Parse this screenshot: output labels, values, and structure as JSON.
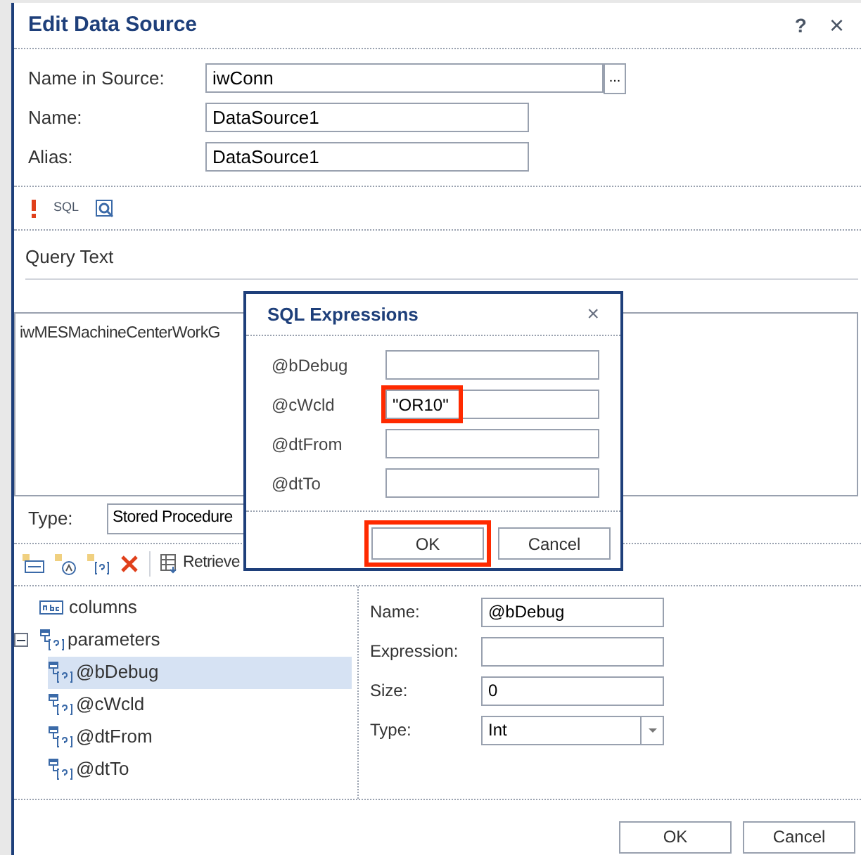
{
  "window": {
    "title": "Edit Data Source",
    "help": "?",
    "close": "×"
  },
  "fields": [
    {
      "label": "Name in Source:",
      "value": "iwConn",
      "browse": "..."
    },
    {
      "label": "Name:",
      "value": "DataSource1"
    },
    {
      "label": "Alias:",
      "value": "DataSource1"
    }
  ],
  "toolbar": {
    "sql_label": "SQL"
  },
  "query": {
    "heading": "Query Text",
    "text": "iwMESMachineCenterWorkG"
  },
  "type": {
    "label": "Type:",
    "value": "Stored Procedure"
  },
  "tree_toolbar": {
    "retrieve": "Retrieve"
  },
  "tree": [
    {
      "label": "columns",
      "kind": "columns",
      "selected": false
    },
    {
      "label": "parameters",
      "kind": "group",
      "expanded": true,
      "selected": false,
      "children": [
        {
          "label": "@bDebug",
          "kind": "param",
          "selected": true
        },
        {
          "label": "@cWcld",
          "kind": "param",
          "selected": false
        },
        {
          "label": "@dtFrom",
          "kind": "param",
          "selected": false
        },
        {
          "label": "@dtTo",
          "kind": "param",
          "selected": false
        }
      ]
    }
  ],
  "properties": [
    {
      "label": "Name:",
      "value": "@bDebug",
      "kind": "text"
    },
    {
      "label": "Expression:",
      "kind": "text"
    },
    {
      "label": "Size:",
      "value": "0",
      "kind": "text"
    },
    {
      "label": "Type:",
      "value": "Int",
      "kind": "select"
    }
  ],
  "buttons": [
    "OK",
    "Cancel"
  ],
  "popup": {
    "title": "SQL Expressions",
    "close": "×",
    "rows": [
      {
        "label": "@bDebug",
        "highlighted": false
      },
      {
        "label": "@cWcld",
        "value": "\"OR10\"",
        "highlighted": true
      },
      {
        "label": "@dtFrom",
        "highlighted": false
      },
      {
        "label": "@dtTo",
        "highlighted": false
      }
    ],
    "buttons": [
      {
        "label": "OK",
        "highlighted": true
      },
      {
        "label": "Cancel",
        "highlighted": false
      }
    ]
  }
}
